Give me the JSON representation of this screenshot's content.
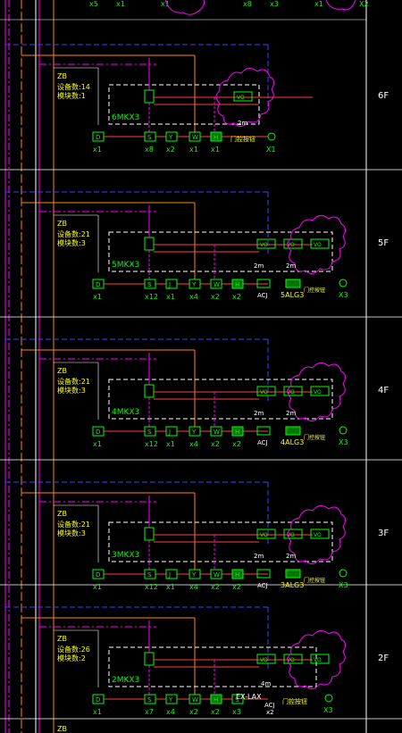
{
  "top_row": {
    "labels": [
      "x5",
      "x1",
      "x1",
      "x8",
      "x3",
      "x1",
      "X2"
    ]
  },
  "floors": [
    {
      "floor": "6F",
      "box": "6MKX3",
      "info_line1": "设备数:14",
      "info_line2": "模块数:1",
      "devices": [
        {
          "sym": "D",
          "label": "x1"
        },
        {
          "sym": "S",
          "label": "x8"
        },
        {
          "sym": "Y",
          "label": "x2"
        },
        {
          "sym": "W",
          "label": "x1"
        },
        {
          "sym": "H",
          "label": "x1"
        }
      ],
      "right_labels": [
        "2m",
        "门控按钮",
        "X1"
      ]
    },
    {
      "floor": "5F",
      "box": "5MKX3",
      "info_line1": "设备数:21",
      "info_line2": "模块数:3",
      "devices": [
        {
          "sym": "D",
          "label": "x1"
        },
        {
          "sym": "S",
          "label": "x12"
        },
        {
          "sym": "J",
          "label": "x1"
        },
        {
          "sym": "Y",
          "label": "x4"
        },
        {
          "sym": "W",
          "label": "x2"
        },
        {
          "sym": "H",
          "label": "x2"
        }
      ],
      "right_labels": [
        "2m",
        "ACJ",
        "2m",
        "5ALG3",
        "门控按钮",
        "X3"
      ]
    },
    {
      "floor": "4F",
      "box": "4MKX3",
      "info_line1": "设备数:21",
      "info_line2": "模块数:3",
      "devices": [
        {
          "sym": "D",
          "label": "x1"
        },
        {
          "sym": "S",
          "label": "x12"
        },
        {
          "sym": "J",
          "label": "x1"
        },
        {
          "sym": "Y",
          "label": "x4"
        },
        {
          "sym": "W",
          "label": "x2"
        },
        {
          "sym": "H",
          "label": "x2"
        }
      ],
      "right_labels": [
        "2m",
        "ACJ",
        "2m",
        "4ALG3",
        "门控按钮",
        "X3"
      ]
    },
    {
      "floor": "3F",
      "box": "3MKX3",
      "info_line1": "设备数:21",
      "info_line2": "模块数:3",
      "devices": [
        {
          "sym": "D",
          "label": "x1"
        },
        {
          "sym": "S",
          "label": "x12"
        },
        {
          "sym": "J",
          "label": "x1"
        },
        {
          "sym": "Y",
          "label": "x4"
        },
        {
          "sym": "W",
          "label": "x2"
        },
        {
          "sym": "H",
          "label": "x2"
        }
      ],
      "right_labels": [
        "2m",
        "ACJ",
        "2m",
        "3ALG3",
        "门控按钮",
        "X3"
      ]
    },
    {
      "floor": "2F",
      "box": "2MKX3",
      "info_line1": "设备数:26",
      "info_line2": "模块数:2",
      "devices": [
        {
          "sym": "D",
          "label": "x1"
        },
        {
          "sym": "S",
          "label": "x7"
        },
        {
          "sym": "Y",
          "label": "x4"
        },
        {
          "sym": "W",
          "label": "x2"
        },
        {
          "sym": "H",
          "label": "x2"
        },
        {
          "sym": "S",
          "label": "x3"
        }
      ],
      "right_labels": [
        "4m",
        "ACJ",
        "x2",
        "门控按钮",
        "X3"
      ]
    }
  ],
  "bottom_label": "ZB",
  "zb": "ZB",
  "bottom_partial": "EX-LAX"
}
